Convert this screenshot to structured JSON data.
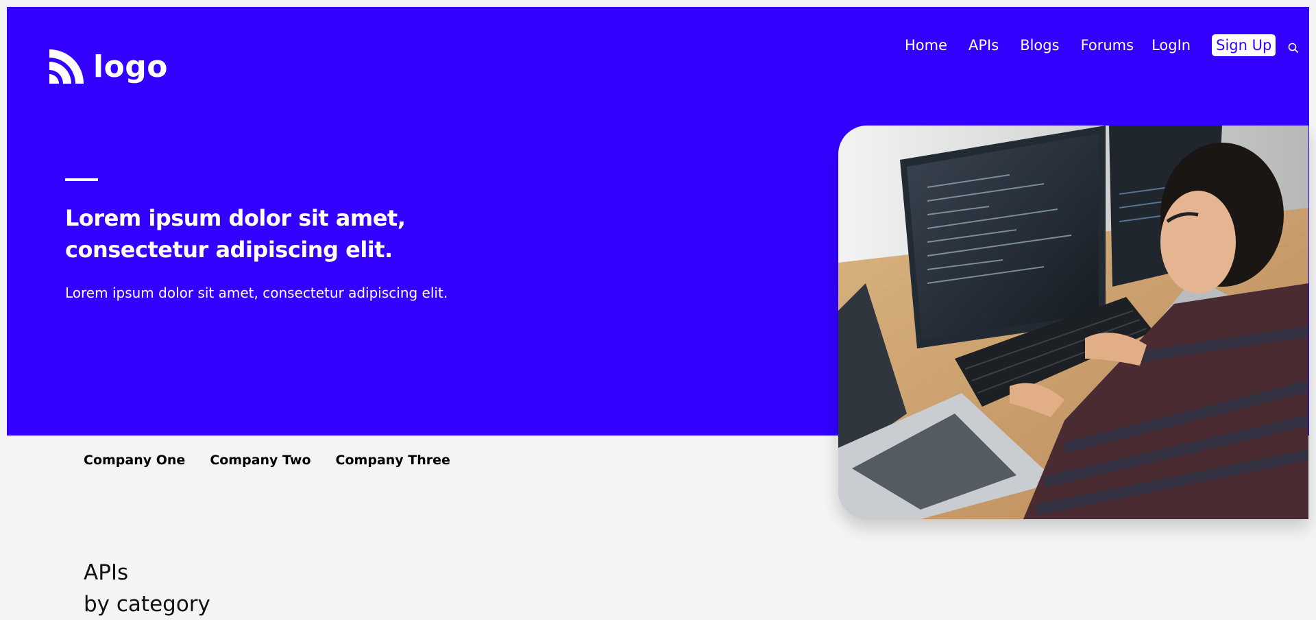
{
  "header": {
    "logo_text": "logo",
    "nav": [
      "Home",
      "APIs",
      "Blogs",
      "Forums",
      "LogIn"
    ],
    "signup_label": "Sign Up",
    "search_icon": "search-icon"
  },
  "hero": {
    "headline_line1": "Lorem ipsum dolor sit amet,",
    "headline_line2": "consectetur adipiscing elit.",
    "subtitle": "Lorem ipsum dolor sit amet, consectetur adipiscing elit.",
    "image": "developer-at-desk-photo"
  },
  "companies": [
    "Company One",
    "Company Two",
    "Company Three"
  ],
  "section": {
    "title_line1": "APIs",
    "title_line2": "by category"
  },
  "colors": {
    "accent": "#3300ff",
    "background": "#f4f4f4",
    "text_on_accent": "#ffffff"
  }
}
